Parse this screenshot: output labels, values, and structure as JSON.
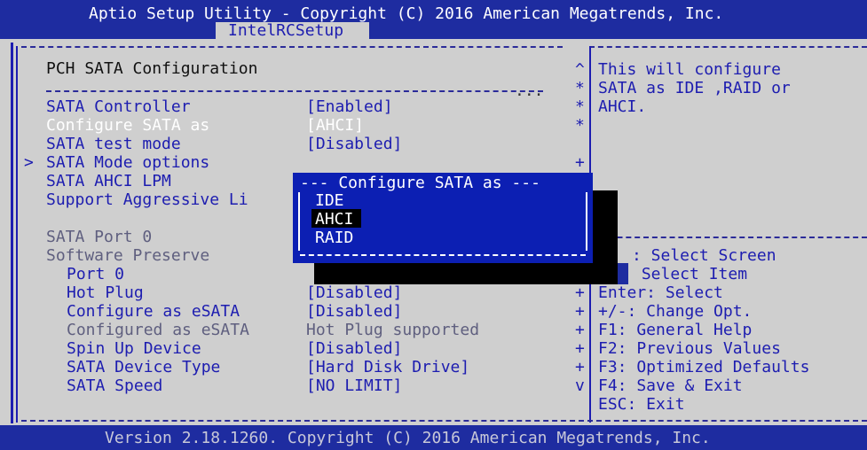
{
  "header": {
    "title": "Aptio Setup Utility - Copyright (C) 2016 American Megatrends, Inc.",
    "tab": "IntelRCSetup"
  },
  "section_title": "PCH SATA Configuration",
  "rows": [
    {
      "label": "SATA Controller",
      "value": "[Enabled]",
      "style": "normal"
    },
    {
      "label": "Configure SATA as",
      "value": "[AHCI]",
      "style": "highlight"
    },
    {
      "label": "SATA test mode",
      "value": "[Disabled]",
      "style": "normal"
    },
    {
      "label": "SATA Mode options",
      "value": "",
      "style": "normal",
      "prefix": ">"
    },
    {
      "label": "SATA AHCI LPM",
      "value": "",
      "style": "normal"
    },
    {
      "label": "Support Aggressive Li",
      "value": "",
      "style": "normal"
    },
    {
      "label": "SATA Port 0",
      "value": "",
      "style": "grey"
    },
    {
      "label": "Software Preserve",
      "value": "",
      "style": "grey"
    },
    {
      "label": "Port 0",
      "value": "",
      "style": "normal"
    },
    {
      "label": "Hot Plug",
      "value": "[Disabled]",
      "style": "normal"
    },
    {
      "label": "Configure as eSATA",
      "value": "[Disabled]",
      "style": "normal"
    },
    {
      "label": "Configured as eSATA",
      "value": "Hot Plug supported",
      "style": "grey"
    },
    {
      "label": "Spin Up Device",
      "value": "[Disabled]",
      "style": "normal"
    },
    {
      "label": "SATA Device Type",
      "value": "[Hard Disk Drive]",
      "style": "normal"
    },
    {
      "label": "SATA Speed",
      "value": "[NO LIMIT]",
      "style": "normal"
    }
  ],
  "help_text": [
    "This will configure",
    "SATA as IDE ,RAID or",
    "AHCI."
  ],
  "keys": [
    ": Select Screen",
    " Select Item",
    "Enter: Select",
    "+/-: Change Opt.",
    "F1: General Help",
    "F2: Previous Values",
    "F3: Optimized Defaults",
    "F4: Save & Exit",
    "ESC: Exit"
  ],
  "popup": {
    "title": "--- Configure SATA as ---",
    "options": [
      "IDE",
      "AHCI",
      "RAID"
    ],
    "selected": "AHCI"
  },
  "footer": "Version 2.18.1260. Copyright (C) 2016 American Megatrends, Inc.",
  "scroll_markers": [
    "^",
    "*",
    "*",
    "*",
    "+",
    "+",
    "+",
    "+",
    "+",
    "+",
    "+",
    "v"
  ]
}
